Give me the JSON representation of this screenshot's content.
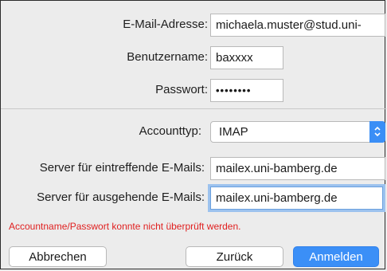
{
  "form": {
    "email_label": "E-Mail-Adresse:",
    "email_value": "michaela.muster@stud.uni-",
    "username_label": "Benutzername:",
    "username_value": "baxxxx",
    "password_label": "Passwort:",
    "password_value": "••••••••",
    "account_type_label": "Accounttyp:",
    "account_type_value": "IMAP",
    "incoming_label": "Server für eintreffende E-Mails:",
    "incoming_value": "mailex.uni-bamberg.de",
    "outgoing_label": "Server für ausgehende E-Mails:",
    "outgoing_value": "mailex.uni-bamberg.de",
    "error_message": "Accountname/Passwort konnte nicht überprüft werden."
  },
  "buttons": {
    "cancel_label": "Abbrechen",
    "back_label": "Zurück",
    "signin_label": "Anmelden"
  },
  "colors": {
    "accent": "#3b8ff7",
    "error": "#e02020",
    "focus_ring": "#9cc2ee"
  },
  "icons": {
    "select_arrows": "chevron-up-down-icon"
  }
}
